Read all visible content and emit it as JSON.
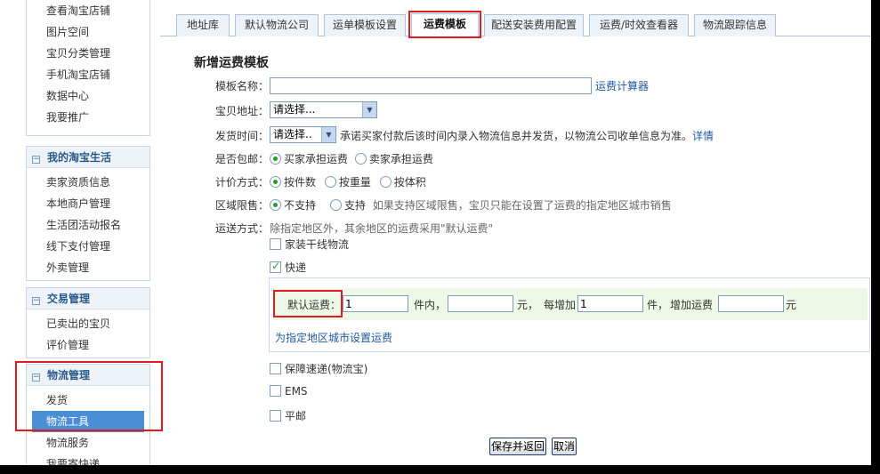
{
  "sidebar": {
    "group0_items": [
      "查看淘宝店铺",
      "图片空间",
      "宝贝分类管理",
      "手机淘宝店铺",
      "数据中心",
      "我要推广"
    ],
    "group1": {
      "title": "我的淘宝生活",
      "items": [
        "卖家资质信息",
        "本地商户管理",
        "生活团活动报名",
        "线下支付管理",
        "外卖管理"
      ]
    },
    "group2": {
      "title": "交易管理",
      "items": [
        "已卖出的宝贝",
        "评价管理"
      ]
    },
    "group3": {
      "title": "物流管理",
      "items": [
        "发货",
        "物流工具",
        "物流服务",
        "我要寄快递"
      ],
      "active_index": 1
    },
    "toggle_symbol": "−"
  },
  "tabs": [
    "地址库",
    "默认物流公司",
    "运单模板设置",
    "运费模板",
    "配送安装费用配置",
    "运费/时效查看器",
    "物流跟踪信息"
  ],
  "active_tab": "运费模板",
  "form": {
    "title": "新增运费模板",
    "template_name": {
      "label": "模板名称：",
      "value": "",
      "calc_link": "运费计算器"
    },
    "item_address": {
      "label": "宝贝地址：",
      "value": "请选择..."
    },
    "ship_time": {
      "label": "发货时间：",
      "value": "请选择..",
      "note": "承诺买家付款后该时间内录入物流信息并发货，以物流公司收单信息为准。",
      "detail_link": "详情"
    },
    "free_shipping": {
      "label": "是否包邮：",
      "options": [
        "买家承担运费",
        "卖家承担运费"
      ],
      "selected": 0
    },
    "pricing": {
      "label": "计价方式：",
      "options": [
        "按件数",
        "按重量",
        "按体积"
      ],
      "selected": 0
    },
    "region": {
      "label": "区域限售：",
      "options": [
        "不支持",
        "支持"
      ],
      "selected": 0,
      "note": "如果支持区域限售，宝贝只能在设置了运费的指定地区城市销售"
    },
    "shipping_methods": {
      "label": "运送方式：",
      "note": "除指定地区外，其余地区的运费采用\"默认运费\"",
      "methods": [
        {
          "name": "家装干线物流",
          "checked": false
        },
        {
          "name": "快递",
          "checked": true
        },
        {
          "name": "保障速递(物流宝)",
          "checked": false
        },
        {
          "name": "EMS",
          "checked": false
        },
        {
          "name": "平邮",
          "checked": false
        }
      ]
    },
    "default_fee": {
      "label": "默认运费：",
      "first_qty": "1",
      "first_unit": "件内，",
      "first_fee": "",
      "fee_unit": "元，",
      "each_add_label": "每增加",
      "add_qty": "1",
      "add_unit": "件，",
      "add_fee_label": "增加运费",
      "add_fee": "",
      "add_fee_unit": "元"
    },
    "city_link": "为指定地区城市设置运费",
    "save_button": "保存并返回",
    "cancel_button": "取消"
  },
  "colors": {
    "highlight": "#e01b24",
    "link": "#1f5a9e",
    "active_nav": "#4a8fd6",
    "default_row_bg": "#eef8e6"
  }
}
